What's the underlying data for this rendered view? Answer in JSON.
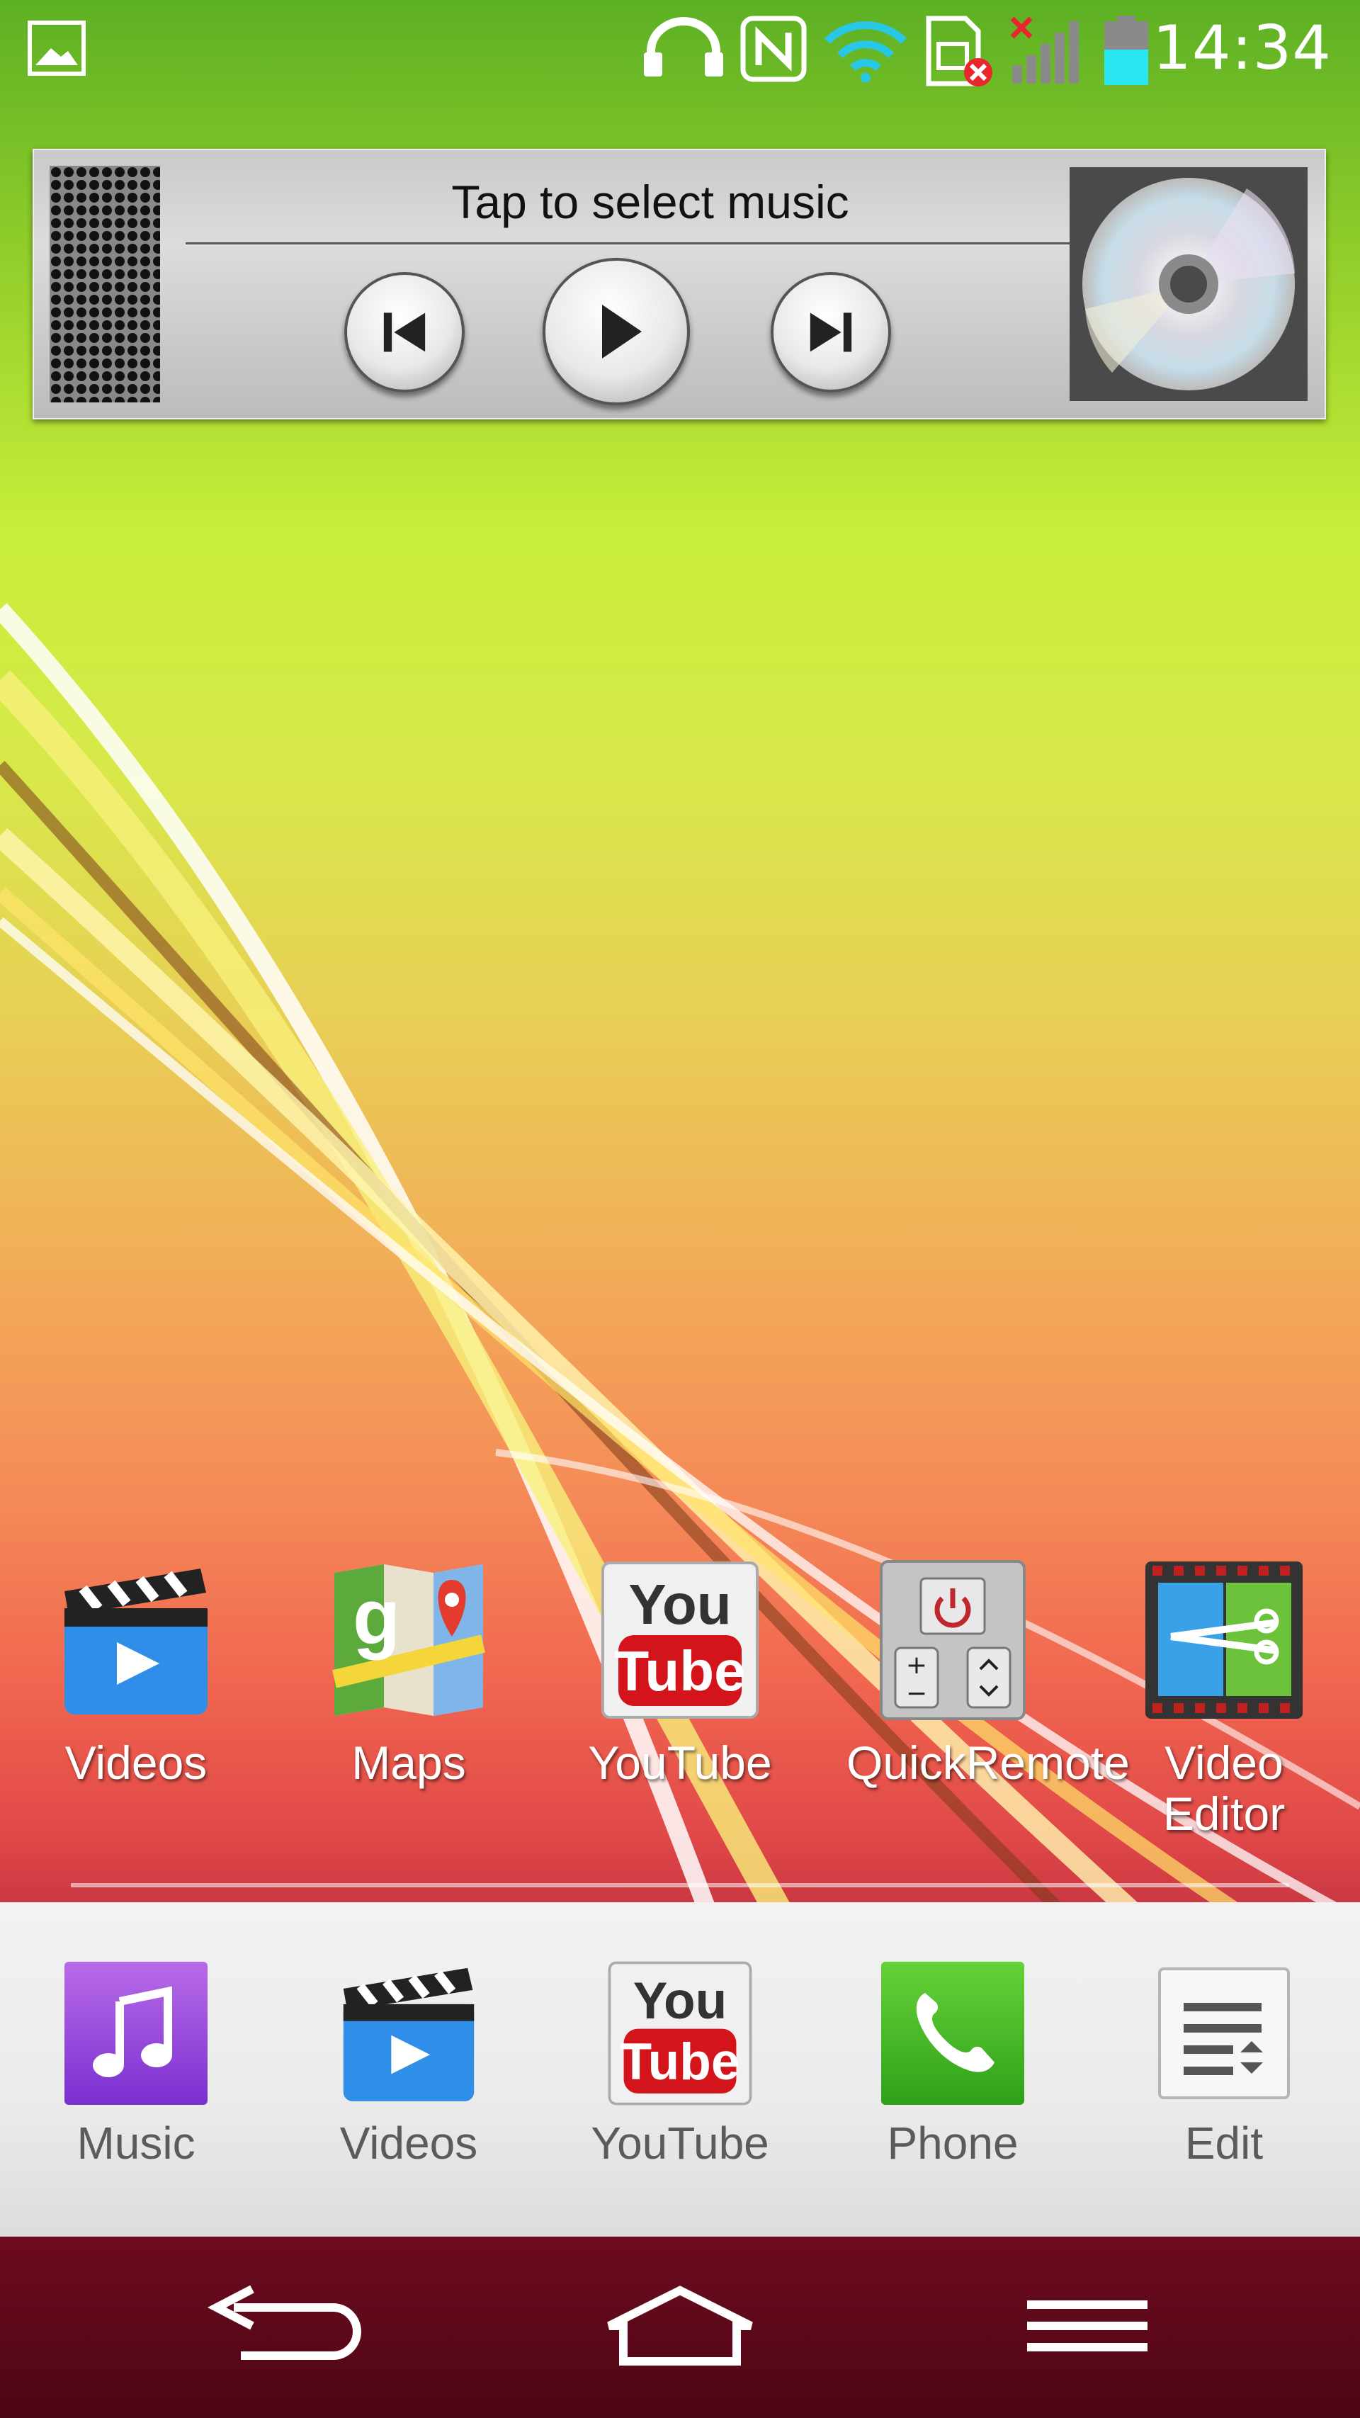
{
  "status_bar": {
    "time": "14:34",
    "icons": [
      "gallery-icon",
      "headphones-icon",
      "nfc-icon",
      "wifi-icon",
      "sim-error-icon",
      "signal-icon",
      "battery-icon"
    ]
  },
  "music_widget": {
    "title": "Tap to select music",
    "controls": [
      "previous",
      "play",
      "next"
    ]
  },
  "home_apps": [
    {
      "label": "Videos",
      "icon": "videos-icon"
    },
    {
      "label": "Maps",
      "icon": "maps-icon"
    },
    {
      "label": "YouTube",
      "icon": "youtube-icon"
    },
    {
      "label": "QuickRemote",
      "icon": "quickremote-icon"
    },
    {
      "label": "Video Editor",
      "icon": "video-editor-icon"
    }
  ],
  "dock": [
    {
      "label": "Music",
      "icon": "music-icon"
    },
    {
      "label": "Videos",
      "icon": "videos-icon"
    },
    {
      "label": "YouTube",
      "icon": "youtube-icon"
    },
    {
      "label": "Phone",
      "icon": "phone-icon"
    },
    {
      "label": "Edit",
      "icon": "edit-icon"
    }
  ],
  "nav_bar": {
    "buttons": [
      "back-icon",
      "home-icon",
      "menu-icon"
    ]
  },
  "colors": {
    "accent_cyan": "#29c7e6",
    "nav_bg": "#5a0a1e",
    "dock_bg": "#ebebeb"
  }
}
